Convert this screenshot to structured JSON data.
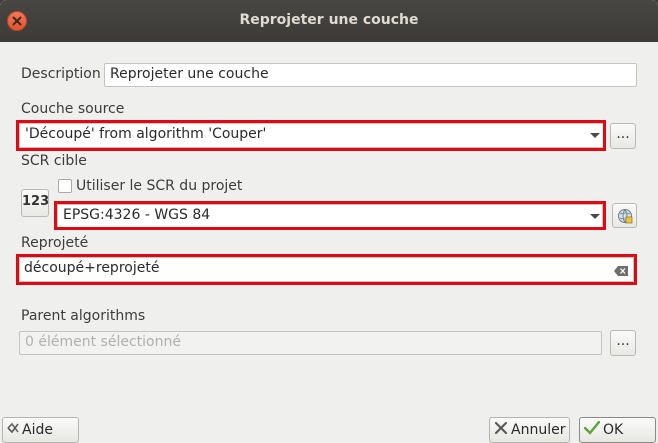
{
  "window": {
    "title": "Reprojeter une couche"
  },
  "description": {
    "label": "Description",
    "value": "Reprojeter une couche"
  },
  "source": {
    "label": "Couche source",
    "value": "'Découpé' from algorithm 'Couper'",
    "browse_label": "..."
  },
  "crs": {
    "label": "SCR cible",
    "crs_button_label": "123",
    "use_project_label": "Utiliser le SCR du projet",
    "value": "EPSG:4326 - WGS 84"
  },
  "reprojected": {
    "label": "Reprojeté",
    "value": "découpé+reprojeté"
  },
  "parent": {
    "label": "Parent algorithms",
    "placeholder": "0 élément sélectionné",
    "browse_label": "..."
  },
  "buttons": {
    "help": "Aide",
    "cancel": "Annuler",
    "ok": "OK"
  },
  "colors": {
    "highlight": "#dc0a14",
    "titlebar": "#3c3b37",
    "close": "#e0542c"
  },
  "icons": {
    "close": "close-icon",
    "browse": "ellipsis-icon",
    "globe": "globe-icon",
    "clear": "clear-text-icon",
    "help": "help-icon",
    "cancel": "cancel-icon",
    "ok": "check-icon"
  }
}
